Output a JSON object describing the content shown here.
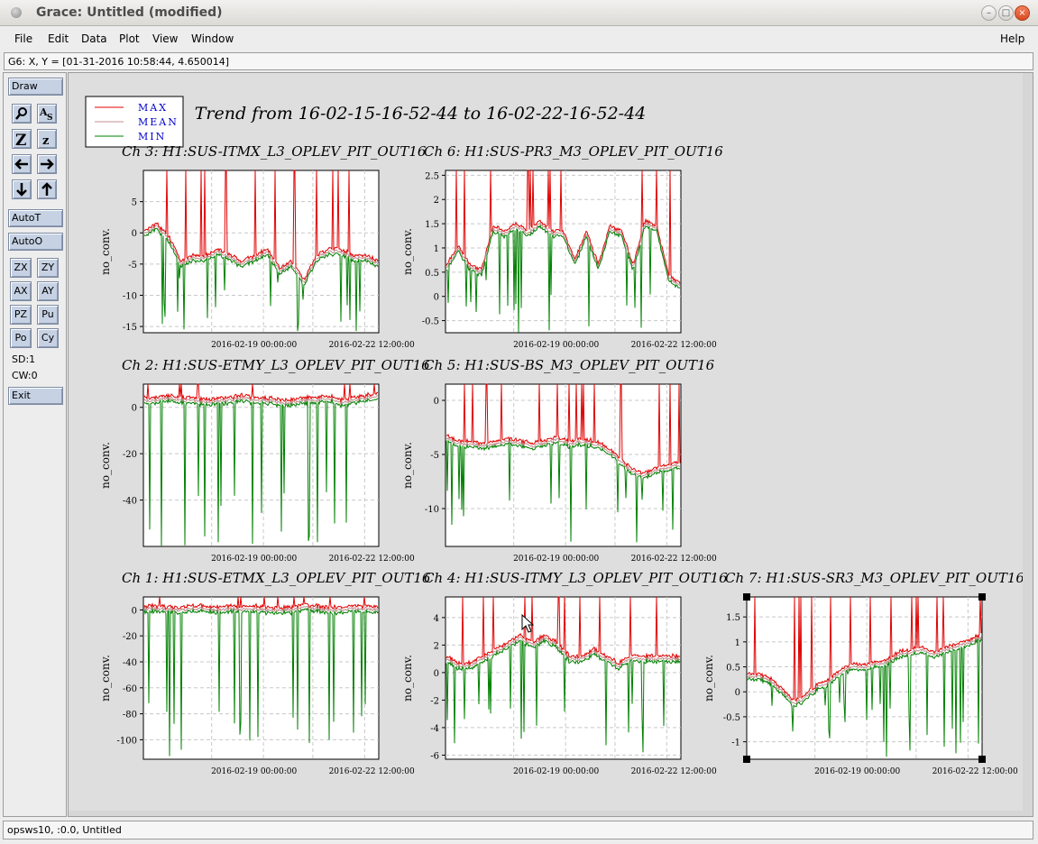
{
  "window": {
    "title": "Grace: Untitled (modified)",
    "controls": [
      "–",
      "□",
      "×"
    ]
  },
  "menubar": {
    "items": [
      "File",
      "Edit",
      "Data",
      "Plot",
      "View",
      "Window"
    ],
    "help": "Help"
  },
  "coord_readout": "G6: X, Y = [01-31-2016 10:58:44, 4.650014]",
  "toolbar": {
    "draw": "Draw",
    "autot": "AutoT",
    "autoo": "AutoO",
    "zx": "ZX",
    "zy": "ZY",
    "ax": "AX",
    "ay": "AY",
    "pz": "PZ",
    "pu": "Pu",
    "po": "Po",
    "cy": "Cy",
    "sd": "SD:1",
    "cw": "CW:0",
    "exit": "Exit",
    "icons": [
      "zoom-icon",
      "text-autoscale-icon",
      "zoom-in-icon",
      "zoom-out-icon",
      "left-arrow-icon",
      "right-arrow-icon",
      "down-arrow-icon",
      "up-arrow-icon"
    ]
  },
  "plot": {
    "title": "Trend from 16-02-15-16-52-44 to 16-02-22-16-52-44",
    "legend": [
      {
        "label": "MAX",
        "color": "#e00000"
      },
      {
        "label": "MEAN",
        "color": "#c09090"
      },
      {
        "label": "MIN",
        "color": "#008000"
      }
    ],
    "ylabel": "no_conv.",
    "xticks": [
      "2016-02-19 00:00:00",
      "2016-02-22 12:00:00"
    ]
  },
  "chart_data": [
    {
      "type": "line",
      "title": "Ch 3: H1:SUS-ITMX_L3_OPLEV_PIT_OUT16",
      "ylabel": "no_conv.",
      "ylim": [
        -16,
        10
      ],
      "yticks": [
        "5",
        "0",
        "-5",
        "-10",
        "-15"
      ],
      "series": [
        {
          "name": "MAX",
          "color": "#e00000"
        },
        {
          "name": "MEAN",
          "color": "#c09090"
        },
        {
          "name": "MIN",
          "color": "#008000"
        }
      ],
      "trend": [
        0,
        1,
        -1,
        -5,
        -4,
        -4,
        -3,
        -4,
        -5,
        -4,
        -3,
        -6,
        -5,
        -8,
        -4,
        -3,
        -3,
        -4,
        -4,
        -5
      ]
    },
    {
      "type": "line",
      "title": "Ch 6: H1:SUS-PR3_M3_OPLEV_PIT_OUT16",
      "ylabel": "no_conv.",
      "ylim": [
        -0.75,
        2.6
      ],
      "yticks": [
        "2.5",
        "2",
        "1.5",
        "1",
        "0.5",
        "0",
        "-0.5"
      ],
      "trend": [
        0.6,
        1.0,
        0.6,
        0.5,
        1.4,
        1.3,
        1.45,
        1.3,
        1.5,
        1.3,
        1.3,
        0.7,
        1.3,
        0.6,
        1.4,
        1.3,
        0.6,
        1.5,
        1.4,
        0.4,
        0.2
      ]
    },
    {
      "type": "line",
      "title": "Ch 2: H1:SUS-ETMY_L3_OPLEV_PIT_OUT16",
      "ylabel": "no_conv.",
      "ylim": [
        -60,
        10
      ],
      "yticks": [
        "0",
        "-20",
        "-40"
      ],
      "trend": [
        3,
        3,
        4,
        3,
        3,
        2,
        3,
        3,
        4,
        3,
        3,
        2,
        2,
        3,
        3,
        4,
        2,
        3,
        4,
        5
      ]
    },
    {
      "type": "line",
      "title": "Ch 5: H1:SUS-BS_M3_OPLEV_PIT_OUT16",
      "ylabel": "no_conv.",
      "ylim": [
        -13.5,
        1.5
      ],
      "yticks": [
        "0",
        "-5",
        "-10"
      ],
      "trend": [
        -3.5,
        -4,
        -4,
        -4.2,
        -4,
        -3.8,
        -4,
        -4.2,
        -4,
        -3.6,
        -4,
        -3.8,
        -4,
        -4.5,
        -5.5,
        -6.5,
        -7,
        -6.5,
        -6.2,
        -6
      ]
    },
    {
      "type": "line",
      "title": "Ch 1: H1:SUS-ETMX_L3_OPLEV_PIT_OUT16",
      "ylabel": "no_conv.",
      "ylim": [
        -115,
        10
      ],
      "yticks": [
        "0",
        "-20",
        "-40",
        "-60",
        "-80",
        "-100"
      ],
      "trend": [
        1,
        1,
        0,
        0,
        1,
        1,
        0,
        1,
        0,
        1,
        0,
        0,
        0,
        2,
        1,
        0,
        0,
        1,
        1,
        0
      ]
    },
    {
      "type": "line",
      "title": "Ch 4: H1:SUS-ITMY_L3_OPLEV_PIT_OUT16",
      "ylabel": "no_conv.",
      "ylim": [
        -6.3,
        5.5
      ],
      "yticks": [
        "4",
        "2",
        "0",
        "-2",
        "-4",
        "-6"
      ],
      "trend": [
        1,
        0.5,
        0.5,
        1,
        1.5,
        2,
        2.5,
        2,
        2.5,
        2,
        1,
        1,
        1.5,
        1,
        0.5,
        1,
        1,
        1,
        1,
        1
      ]
    },
    {
      "type": "line",
      "title": "Ch 7: H1:SUS-SR3_M3_OPLEV_PIT_OUT16",
      "ylabel": "no_conv.",
      "ylim": [
        -1.35,
        1.9
      ],
      "yticks": [
        "1.5",
        "1",
        "0.5",
        "0",
        "-0.5",
        "-1"
      ],
      "trend": [
        0.3,
        0.3,
        0.2,
        0.0,
        -0.25,
        -0.1,
        0.1,
        0.2,
        0.4,
        0.5,
        0.5,
        0.55,
        0.6,
        0.75,
        0.8,
        0.85,
        0.75,
        0.85,
        0.9,
        1.0,
        1.1
      ]
    }
  ],
  "statusbar": "opsws10, :0.0, Untitled"
}
